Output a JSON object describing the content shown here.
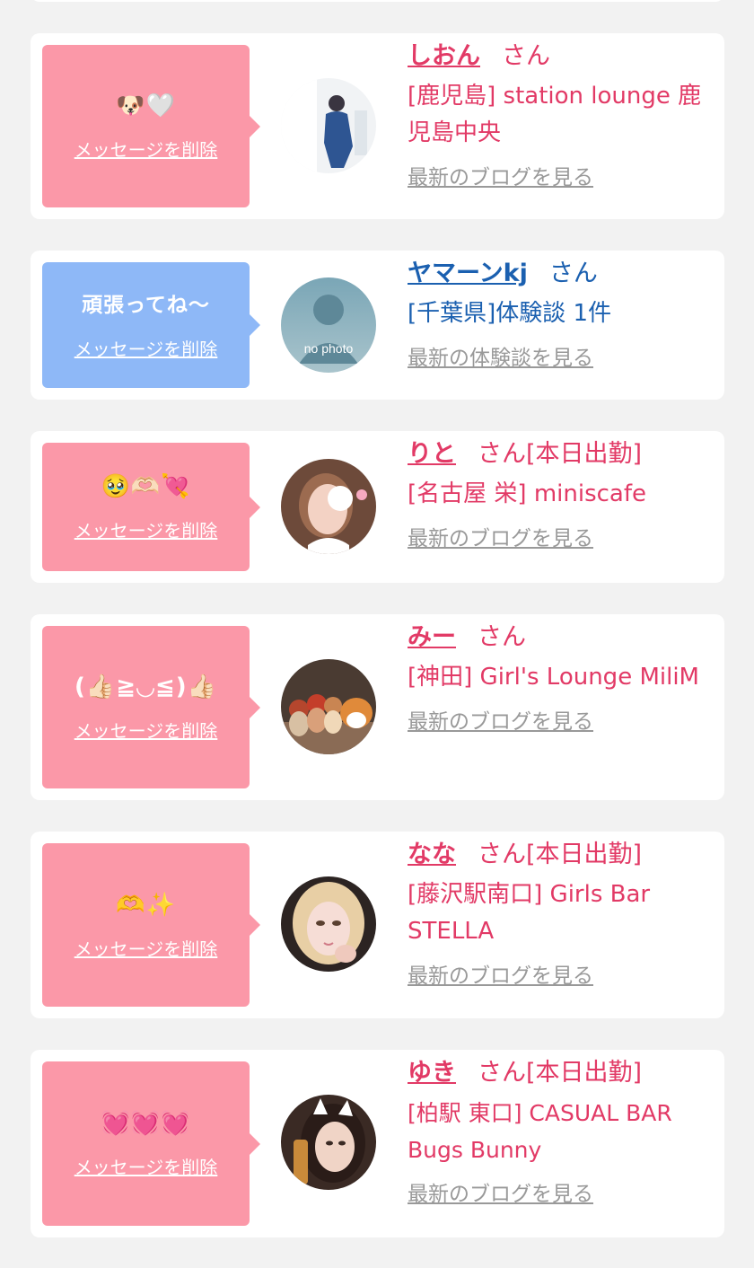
{
  "delete_label": "メッセージを削除",
  "san_suffix": "さん",
  "cards": [
    {
      "message": "🐶🤍",
      "name": "しおん",
      "after_name": "さん",
      "shop": "[鹿児島] station lounge 鹿児島中央",
      "link": "最新のブログを見る",
      "theme": "pink"
    },
    {
      "message": "頑張ってね〜",
      "name": "ヤマーンkj",
      "after_name": "さん",
      "shop": "[千葉県]体験談 1件",
      "link": "最新の体験談を見る",
      "theme": "blue",
      "avatar_text": "no photo"
    },
    {
      "message": "🥹🫶🏻💘",
      "name": "りと",
      "after_name": "さん[本日出勤]",
      "shop": "[名古屋 栄] miniscafe",
      "link": "最新のブログを見る",
      "theme": "pink"
    },
    {
      "message": "(👍🏻≧◡≦)👍🏻",
      "name": "みー",
      "after_name": "さん",
      "shop": "[神田] Girl's Lounge MiliM",
      "link": "最新のブログを見る",
      "theme": "pink"
    },
    {
      "message": "🫶✨",
      "name": "なな",
      "after_name": "さん[本日出勤]",
      "shop": "[藤沢駅南口] Girls Bar STELLA",
      "link": "最新のブログを見る",
      "theme": "pink"
    },
    {
      "message": "💓💓💓",
      "name": "ゆき",
      "after_name": "さん[本日出勤]",
      "shop": "[柏駅 東口] CASUAL BAR Bugs Bunny",
      "link": "最新のブログを見る",
      "theme": "pink"
    }
  ],
  "colors": {
    "pink_bubble": "#fb98a8",
    "blue_bubble": "#8eb8f7",
    "pink_text": "#e23a66",
    "blue_text": "#1b60b0",
    "link_gray": "#999999",
    "page_bg": "#f2f2f2"
  }
}
